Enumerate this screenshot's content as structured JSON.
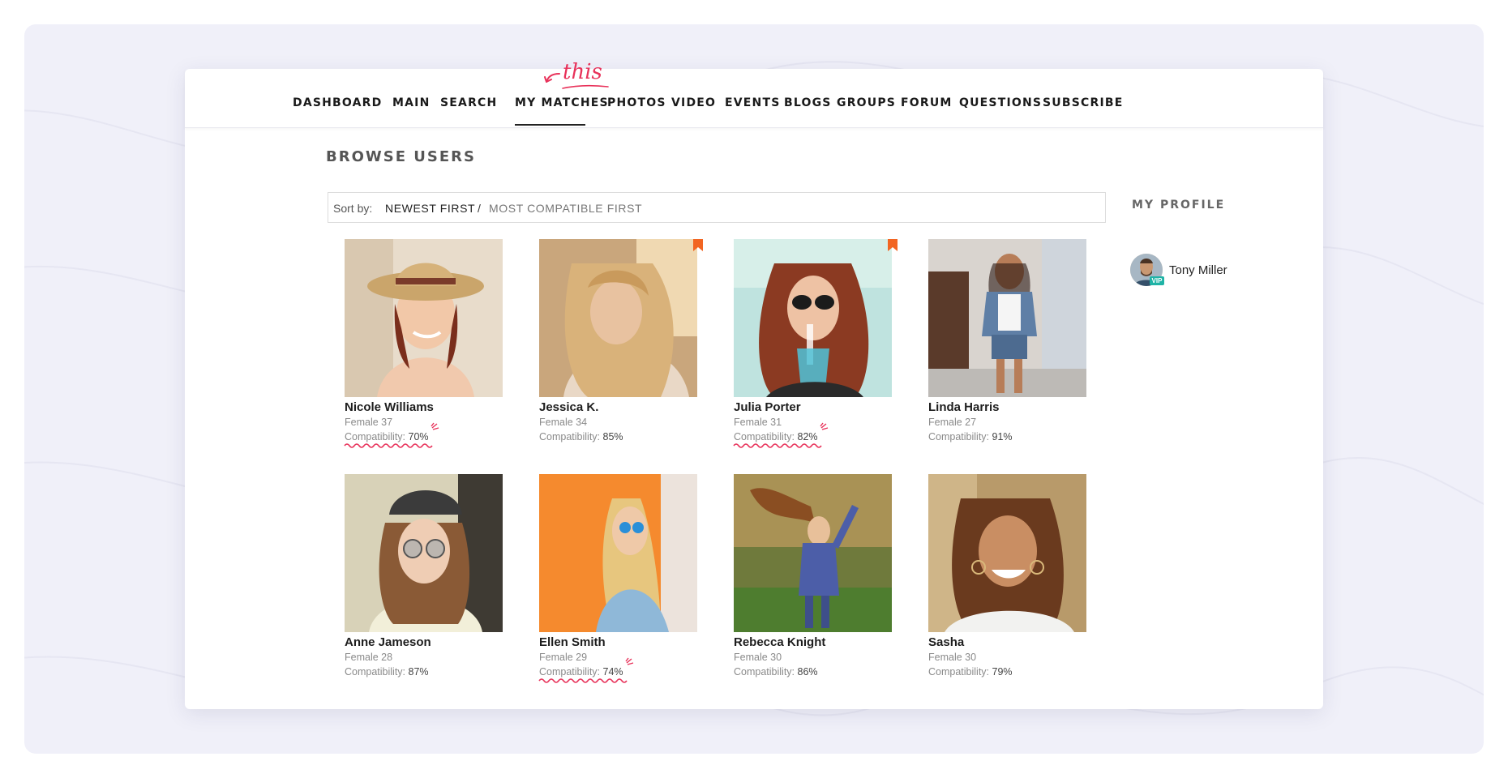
{
  "nav": {
    "items": [
      {
        "label": "DASHBOARD"
      },
      {
        "label": "MAIN"
      },
      {
        "label": "SEARCH"
      },
      {
        "label": "MY MATCHES",
        "active": true
      },
      {
        "label": "PHOTOS"
      },
      {
        "label": "VIDEO"
      },
      {
        "label": "EVENTS"
      },
      {
        "label": "BLOGS"
      },
      {
        "label": "GROUPS"
      },
      {
        "label": "FORUM"
      },
      {
        "label": "QUESTIONS"
      },
      {
        "label": "SUBSCRIBE"
      }
    ],
    "annotation": "this"
  },
  "page": {
    "title": "BROWSE USERS",
    "sort": {
      "label": "Sort by:",
      "newest": "NEWEST FIRST",
      "separator": "/",
      "compatible": "MOST COMPATIBLE FIRST"
    }
  },
  "users": [
    {
      "name": "Nicole Williams",
      "desc": "Female 37",
      "compat_label": "Compatibility:",
      "compat": "70%",
      "bookmarked": false,
      "highlighted": true
    },
    {
      "name": "Jessica K.",
      "desc": "Female 34",
      "compat_label": "Compatibility:",
      "compat": "85%",
      "bookmarked": true,
      "highlighted": false
    },
    {
      "name": "Julia Porter",
      "desc": "Female 31",
      "compat_label": "Compatibility:",
      "compat": "82%",
      "bookmarked": true,
      "highlighted": true
    },
    {
      "name": "Linda Harris",
      "desc": "Female 27",
      "compat_label": "Compatibility:",
      "compat": "91%",
      "bookmarked": false,
      "highlighted": false
    },
    {
      "name": "Anne Jameson",
      "desc": "Female 28",
      "compat_label": "Compatibility:",
      "compat": "87%",
      "bookmarked": false,
      "highlighted": false
    },
    {
      "name": "Ellen Smith",
      "desc": "Female 29",
      "compat_label": "Compatibility:",
      "compat": "74%",
      "bookmarked": false,
      "highlighted": true
    },
    {
      "name": "Rebecca Knight",
      "desc": "Female 30",
      "compat_label": "Compatibility:",
      "compat": "86%",
      "bookmarked": false,
      "highlighted": false
    },
    {
      "name": "Sasha",
      "desc": "Female 30",
      "compat_label": "Compatibility:",
      "compat": "79%",
      "bookmarked": false,
      "highlighted": false
    }
  ],
  "sidebar": {
    "title": "MY PROFILE",
    "profile_name": "Tony Miller",
    "badge": "VIP"
  },
  "colors": {
    "bookmark": "#f26522",
    "annotation": "#e8325a",
    "vip": "#1fb3a6"
  }
}
